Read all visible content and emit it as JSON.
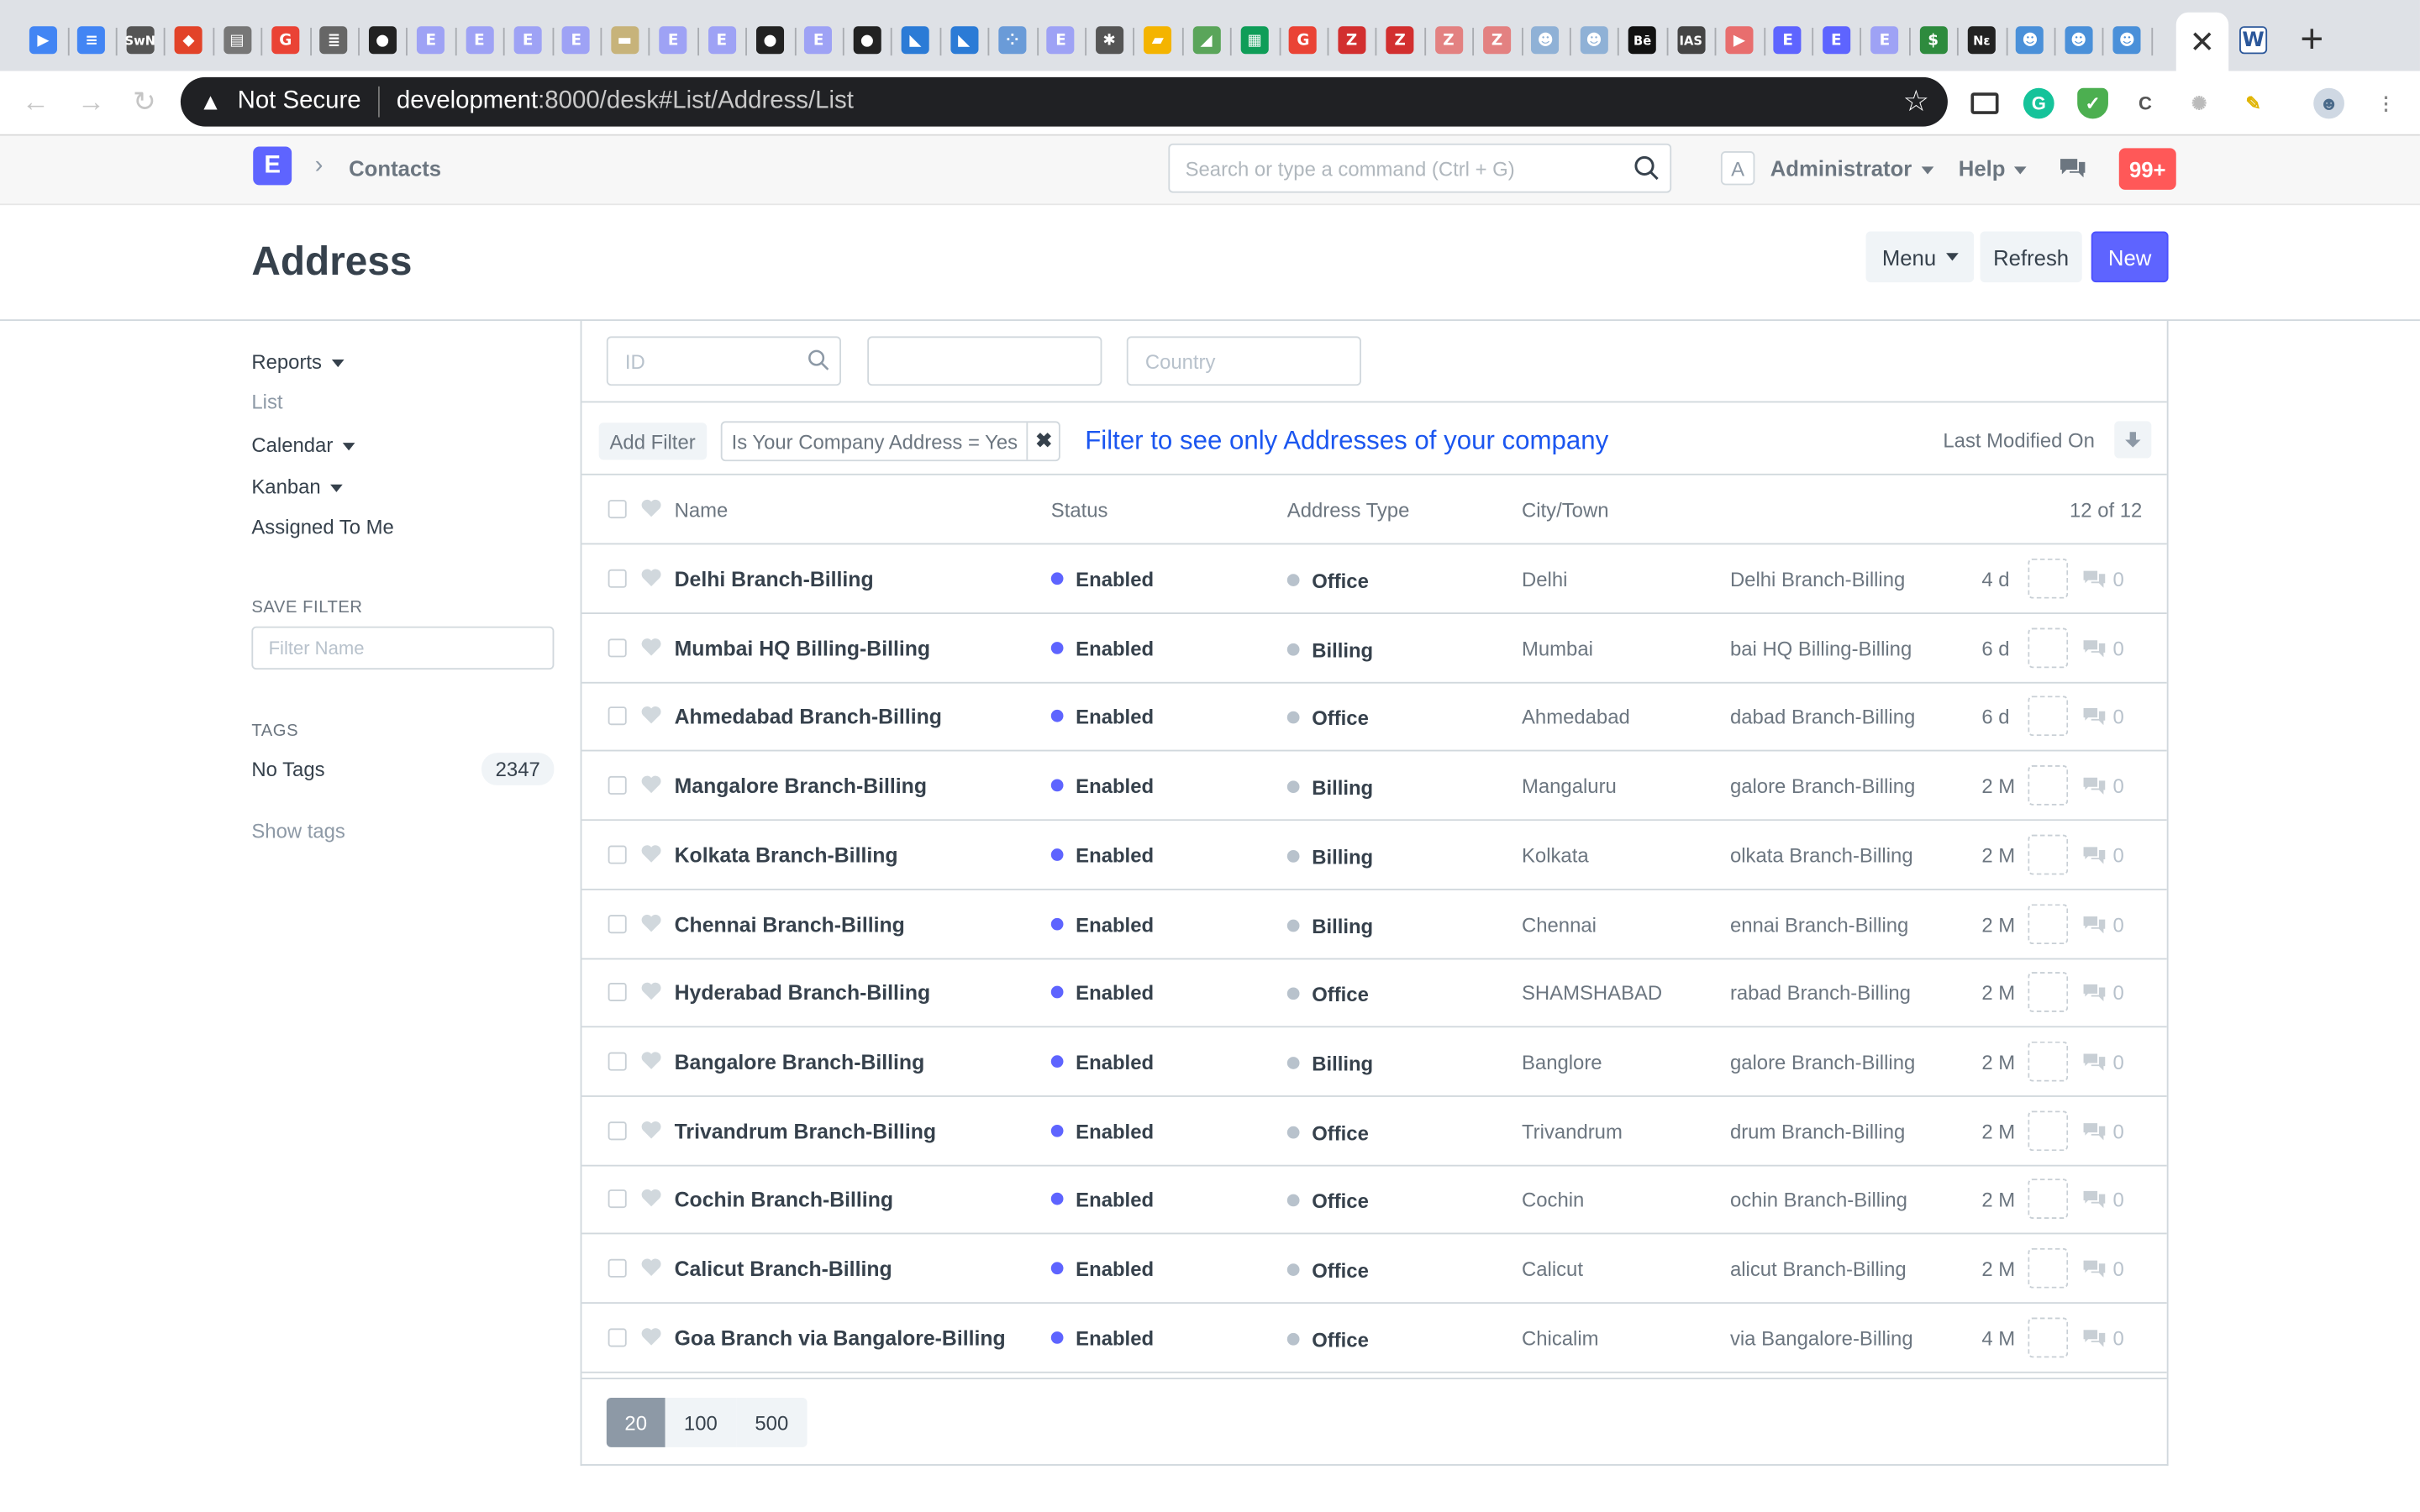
{
  "browser": {
    "tabs": [
      {
        "icon": "google-play-icon",
        "color": "#4285f4",
        "glyph": "▶"
      },
      {
        "icon": "google-docs-icon",
        "color": "#4285f4",
        "glyph": "≡"
      },
      {
        "icon": "swn-icon",
        "color": "#555555",
        "glyph": "SwN"
      },
      {
        "icon": "gitlab-icon",
        "color": "#e24329",
        "glyph": "◆"
      },
      {
        "icon": "reader-icon",
        "color": "#777777",
        "glyph": "▤"
      },
      {
        "icon": "google-icon",
        "color": "#ea4335",
        "glyph": "G"
      },
      {
        "icon": "notes-icon",
        "color": "#666666",
        "glyph": "≣"
      },
      {
        "icon": "github-icon",
        "color": "#222222",
        "glyph": "●"
      },
      {
        "icon": "erpnext-icon",
        "color": "#9ea2f5",
        "glyph": "E"
      },
      {
        "icon": "erpnext-icon",
        "color": "#9ea2f5",
        "glyph": "E"
      },
      {
        "icon": "erpnext-icon",
        "color": "#9ea2f5",
        "glyph": "E"
      },
      {
        "icon": "erpnext-icon",
        "color": "#9ea2f5",
        "glyph": "E"
      },
      {
        "icon": "image-icon",
        "color": "#c7b37a",
        "glyph": "▬"
      },
      {
        "icon": "erpnext-icon",
        "color": "#9ea2f5",
        "glyph": "E"
      },
      {
        "icon": "erpnext-icon",
        "color": "#9ea2f5",
        "glyph": "E"
      },
      {
        "icon": "github-icon",
        "color": "#222222",
        "glyph": "●"
      },
      {
        "icon": "erpnext-icon",
        "color": "#9ea2f5",
        "glyph": "E"
      },
      {
        "icon": "github-icon",
        "color": "#222222",
        "glyph": "●"
      },
      {
        "icon": "vscode-icon",
        "color": "#2b7bd6",
        "glyph": "◣"
      },
      {
        "icon": "vscode-icon",
        "color": "#2b7bd6",
        "glyph": "◣"
      },
      {
        "icon": "dots-icon",
        "color": "#6a9bd8",
        "glyph": "⁘"
      },
      {
        "icon": "erpnext-icon",
        "color": "#9ea2f5",
        "glyph": "E"
      },
      {
        "icon": "puzzle-icon",
        "color": "#555555",
        "glyph": "✱"
      },
      {
        "icon": "folder-icon",
        "color": "#f4b400",
        "glyph": "▰"
      },
      {
        "icon": "chart-icon",
        "color": "#5aa55a",
        "glyph": "◢"
      },
      {
        "icon": "sheets-icon",
        "color": "#0f9d58",
        "glyph": "▦"
      },
      {
        "icon": "google-icon",
        "color": "#ea4335",
        "glyph": "G"
      },
      {
        "icon": "zotero-icon",
        "color": "#d22f2f",
        "glyph": "Z"
      },
      {
        "icon": "zotero-icon",
        "color": "#d22f2f",
        "glyph": "Z"
      },
      {
        "icon": "zotero-icon",
        "color": "#e38181",
        "glyph": "Z"
      },
      {
        "icon": "zotero-icon",
        "color": "#e38181",
        "glyph": "Z"
      },
      {
        "icon": "person-icon",
        "color": "#8fb1d6",
        "glyph": "☻"
      },
      {
        "icon": "person-icon",
        "color": "#8fb1d6",
        "glyph": "☻"
      },
      {
        "icon": "behance-icon",
        "color": "#111111",
        "glyph": "Bē"
      },
      {
        "icon": "ias-icon",
        "color": "#444444",
        "glyph": "IAS"
      },
      {
        "icon": "youtube-icon",
        "color": "#e86e6e",
        "glyph": "▶"
      },
      {
        "icon": "erpnext-icon",
        "color": "#5e64ff",
        "glyph": "E"
      },
      {
        "icon": "erpnext-icon",
        "color": "#5e64ff",
        "glyph": "E"
      },
      {
        "icon": "erpnext-icon",
        "color": "#9ea2f5",
        "glyph": "E"
      },
      {
        "icon": "dollar-icon",
        "color": "#2e8b3e",
        "glyph": "$"
      },
      {
        "icon": "notion-icon",
        "color": "#222222",
        "glyph": "Nε"
      },
      {
        "icon": "person-icon",
        "color": "#4a90d9",
        "glyph": "☻"
      },
      {
        "icon": "person-icon",
        "color": "#4a90d9",
        "glyph": "☻"
      },
      {
        "icon": "person-icon",
        "color": "#4a90d9",
        "glyph": "☻"
      }
    ],
    "active_tab_glyph": "✕",
    "last_tab_glyph": "W",
    "new_tab_glyph": "+",
    "security_label": "Not Secure",
    "url_host": "development",
    "url_rest": ":8000/desk#List/Address/List"
  },
  "navbar": {
    "logo": "E",
    "breadcrumb": "Contacts",
    "search_placeholder": "Search or type a command (Ctrl + G)",
    "avatar_letter": "A",
    "user": "Administrator",
    "help": "Help",
    "notifications": "99+"
  },
  "page": {
    "title": "Address",
    "menu_label": "Menu",
    "refresh_label": "Refresh",
    "new_label": "New"
  },
  "sidebar": {
    "reports": "Reports",
    "list": "List",
    "calendar": "Calendar",
    "kanban": "Kanban",
    "assigned": "Assigned To Me",
    "save_filter_heading": "SAVE FILTER",
    "filter_name_placeholder": "Filter Name",
    "tags_heading": "TAGS",
    "no_tags": "No Tags",
    "no_tags_count": "2347",
    "show_tags": "Show tags"
  },
  "filters": {
    "id_placeholder": "ID",
    "second_value": "",
    "country_placeholder": "Country",
    "add_filter": "Add Filter",
    "active_filter": "Is Your Company Address = Yes",
    "hint": "Filter to see only Addresses of your company",
    "sort_label": "Last Modified On"
  },
  "list": {
    "columns": {
      "name": "Name",
      "status": "Status",
      "address_type": "Address Type",
      "city": "City/Town"
    },
    "count": "12 of 12",
    "rows": [
      {
        "name": "Delhi Branch-Billing",
        "status": "Enabled",
        "type": "Office",
        "city": "Delhi",
        "title": "Delhi Branch-Billing",
        "age": "4 d",
        "comments": "0"
      },
      {
        "name": "Mumbai HQ Billing-Billing",
        "status": "Enabled",
        "type": "Billing",
        "city": "Mumbai",
        "title": "bai HQ Billing-Billing",
        "age": "6 d",
        "comments": "0"
      },
      {
        "name": "Ahmedabad Branch-Billing",
        "status": "Enabled",
        "type": "Office",
        "city": "Ahmedabad",
        "title": "dabad Branch-Billing",
        "age": "6 d",
        "comments": "0"
      },
      {
        "name": "Mangalore Branch-Billing",
        "status": "Enabled",
        "type": "Billing",
        "city": "Mangaluru",
        "title": "galore Branch-Billing",
        "age": "2 M",
        "comments": "0"
      },
      {
        "name": "Kolkata Branch-Billing",
        "status": "Enabled",
        "type": "Billing",
        "city": "Kolkata",
        "title": "olkata Branch-Billing",
        "age": "2 M",
        "comments": "0"
      },
      {
        "name": "Chennai Branch-Billing",
        "status": "Enabled",
        "type": "Billing",
        "city": "Chennai",
        "title": "ennai Branch-Billing",
        "age": "2 M",
        "comments": "0"
      },
      {
        "name": "Hyderabad Branch-Billing",
        "status": "Enabled",
        "type": "Office",
        "city": "SHAMSHABAD",
        "title": "rabad Branch-Billing",
        "age": "2 M",
        "comments": "0"
      },
      {
        "name": "Bangalore Branch-Billing",
        "status": "Enabled",
        "type": "Billing",
        "city": "Banglore",
        "title": "galore Branch-Billing",
        "age": "2 M",
        "comments": "0"
      },
      {
        "name": "Trivandrum Branch-Billing",
        "status": "Enabled",
        "type": "Office",
        "city": "Trivandrum",
        "title": "drum Branch-Billing",
        "age": "2 M",
        "comments": "0"
      },
      {
        "name": "Cochin Branch-Billing",
        "status": "Enabled",
        "type": "Office",
        "city": "Cochin",
        "title": "ochin Branch-Billing",
        "age": "2 M",
        "comments": "0"
      },
      {
        "name": "Calicut Branch-Billing",
        "status": "Enabled",
        "type": "Office",
        "city": "Calicut",
        "title": "alicut Branch-Billing",
        "age": "2 M",
        "comments": "0"
      },
      {
        "name": "Goa Branch via Bangalore-Billing",
        "status": "Enabled",
        "type": "Office",
        "city": "Chicalim",
        "title": "via Bangalore-Billing",
        "age": "4 M",
        "comments": "0"
      }
    ]
  },
  "paging": {
    "sizes": [
      "20",
      "100",
      "500"
    ],
    "active": "20"
  },
  "colors": {
    "primary": "#5e64ff",
    "hint": "#1b56f0",
    "badge": "#ff5858"
  }
}
